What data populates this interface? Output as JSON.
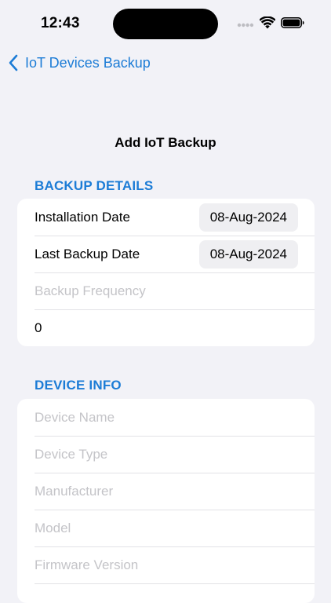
{
  "status_bar": {
    "time": "12:43"
  },
  "nav": {
    "back_label": "IoT Devices Backup",
    "title": "Add IoT Backup"
  },
  "backup_details": {
    "header": "BACKUP DETAILS",
    "installation_date_label": "Installation Date",
    "installation_date_value": "08-Aug-2024",
    "last_backup_date_label": "Last Backup Date",
    "last_backup_date_value": "08-Aug-2024",
    "backup_frequency_placeholder": "Backup Frequency",
    "count_value": "0"
  },
  "device_info": {
    "header": "DEVICE INFO",
    "device_name_placeholder": "Device Name",
    "device_type_placeholder": "Device Type",
    "manufacturer_placeholder": "Manufacturer",
    "model_placeholder": "Model",
    "firmware_version_placeholder": "Firmware Version"
  },
  "colors": {
    "accent": "#1C7CD6",
    "background": "#F2F2F7",
    "placeholder": "#C4C4C8"
  }
}
